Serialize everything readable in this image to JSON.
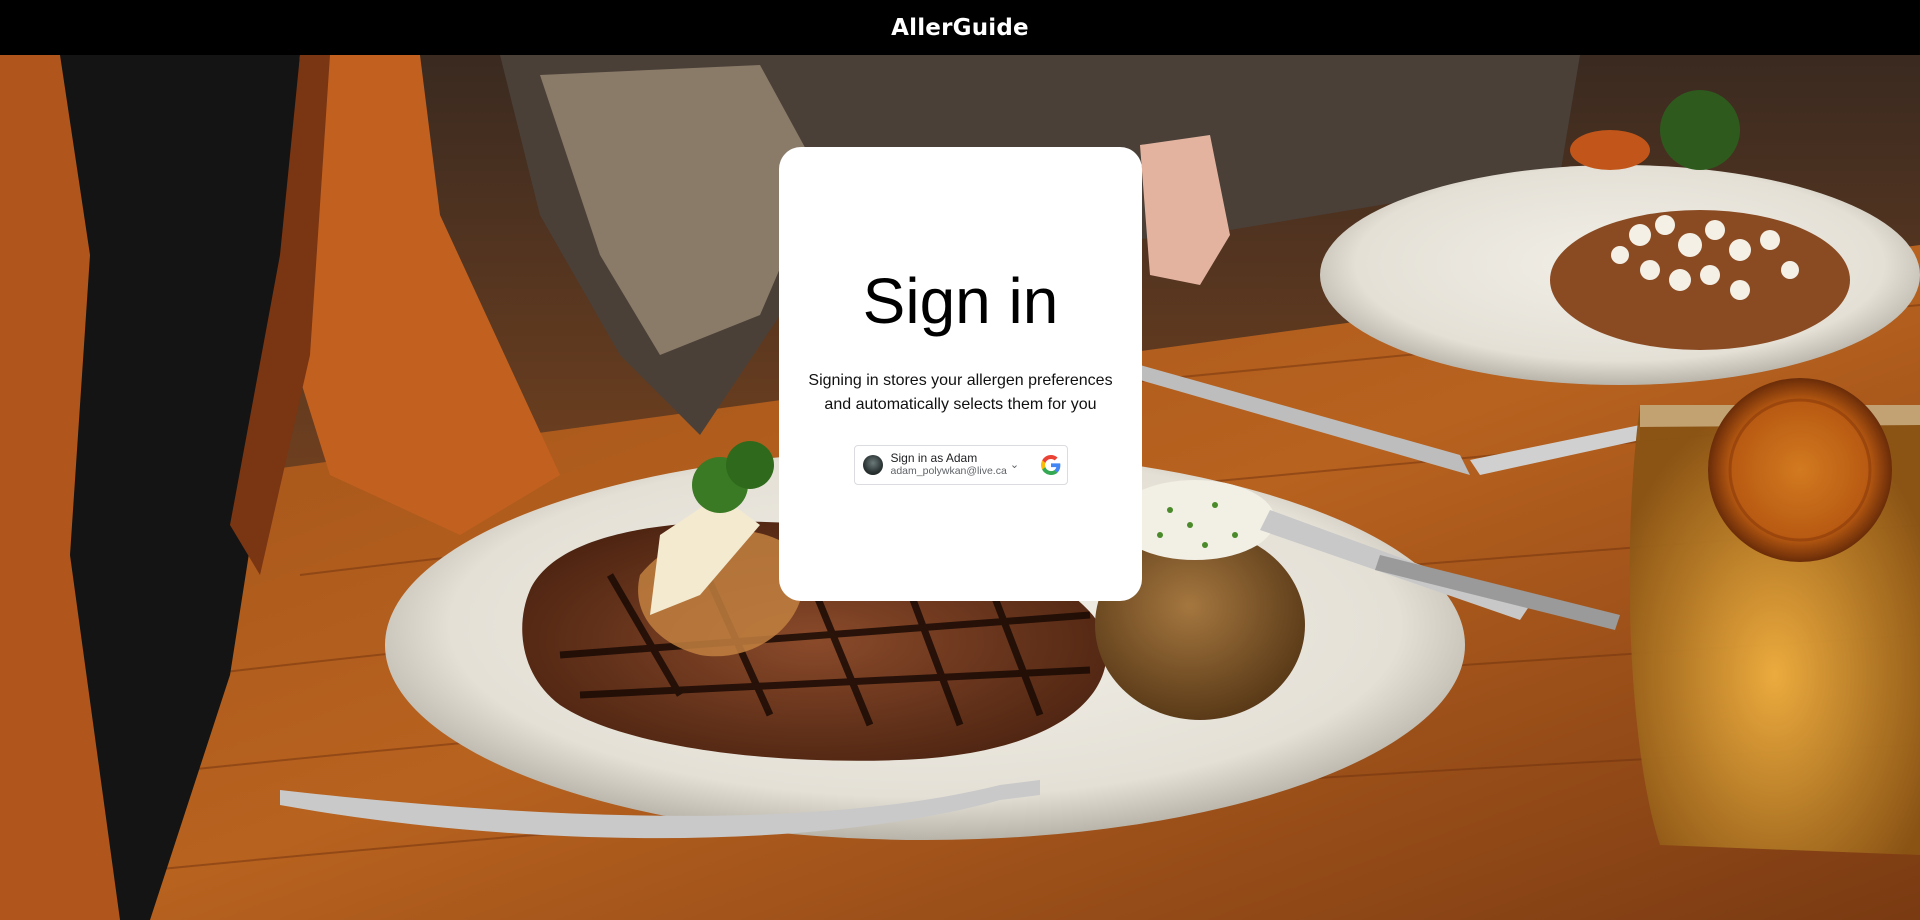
{
  "header": {
    "brand": "AllerGuide"
  },
  "signin": {
    "title": "Sign in",
    "subtitle": "Signing in stores your allergen preferences and automatically selects them for you",
    "google_button": {
      "name_line": "Sign in as Adam",
      "email": "adam_polywkan@live.ca",
      "chevron": "⌄",
      "icon": "google-logo-icon",
      "avatar_icon": "user-avatar-icon"
    }
  },
  "colors": {
    "topbar": "#000000",
    "card": "#ffffff",
    "button_border": "#dadce0"
  }
}
